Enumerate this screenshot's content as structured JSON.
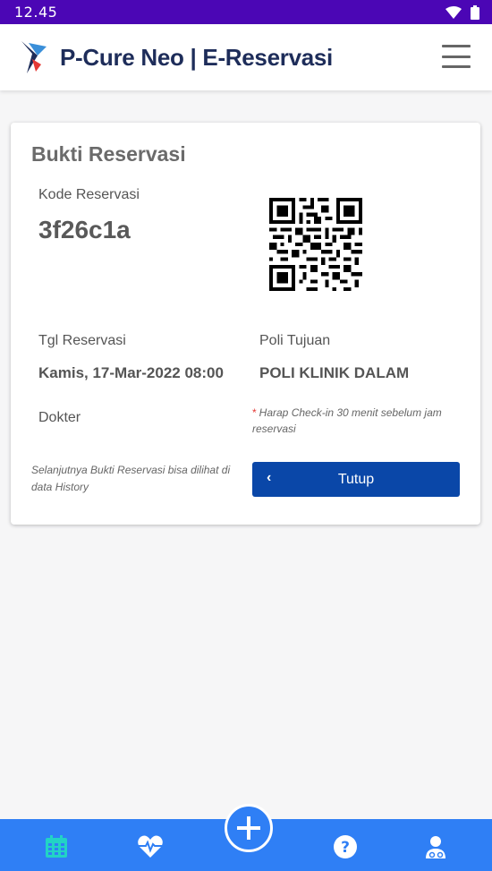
{
  "status_bar": {
    "time": "12.45"
  },
  "app_bar": {
    "title": "P-Cure Neo | E-Reservasi"
  },
  "card": {
    "title": "Bukti Reservasi",
    "kode_label": "Kode Reservasi",
    "kode_value": "3f26c1a",
    "tgl_label": "Tgl Reservasi",
    "tgl_value": "Kamis, 17-Mar-2022 08:00",
    "poli_label": "Poli Tujuan",
    "poli_value": "POLI KLINIK DALAM",
    "dokter_label": "Dokter",
    "note_marker": "*",
    "note_text": "Harap Check-in 30 menit sebelum jam reservasi",
    "history_note": "Selanjutnya Bukti Reservasi bisa dilihat di data History",
    "close_chevron": "‹",
    "close_label": "Tutup"
  },
  "bottom_nav": {
    "items": [
      {
        "icon": "calendar-icon",
        "active": true
      },
      {
        "icon": "heartbeat-icon",
        "active": false
      },
      {
        "icon": "plus-icon",
        "active": false
      },
      {
        "icon": "question-icon",
        "active": false
      },
      {
        "icon": "doctor-icon",
        "active": false
      }
    ]
  },
  "colors": {
    "status_bar": "#4b06b5",
    "primary": "#0a47a8",
    "nav_bg": "#2f7ff5",
    "nav_active": "#22d3c5",
    "title_text": "#1e2d5a"
  }
}
